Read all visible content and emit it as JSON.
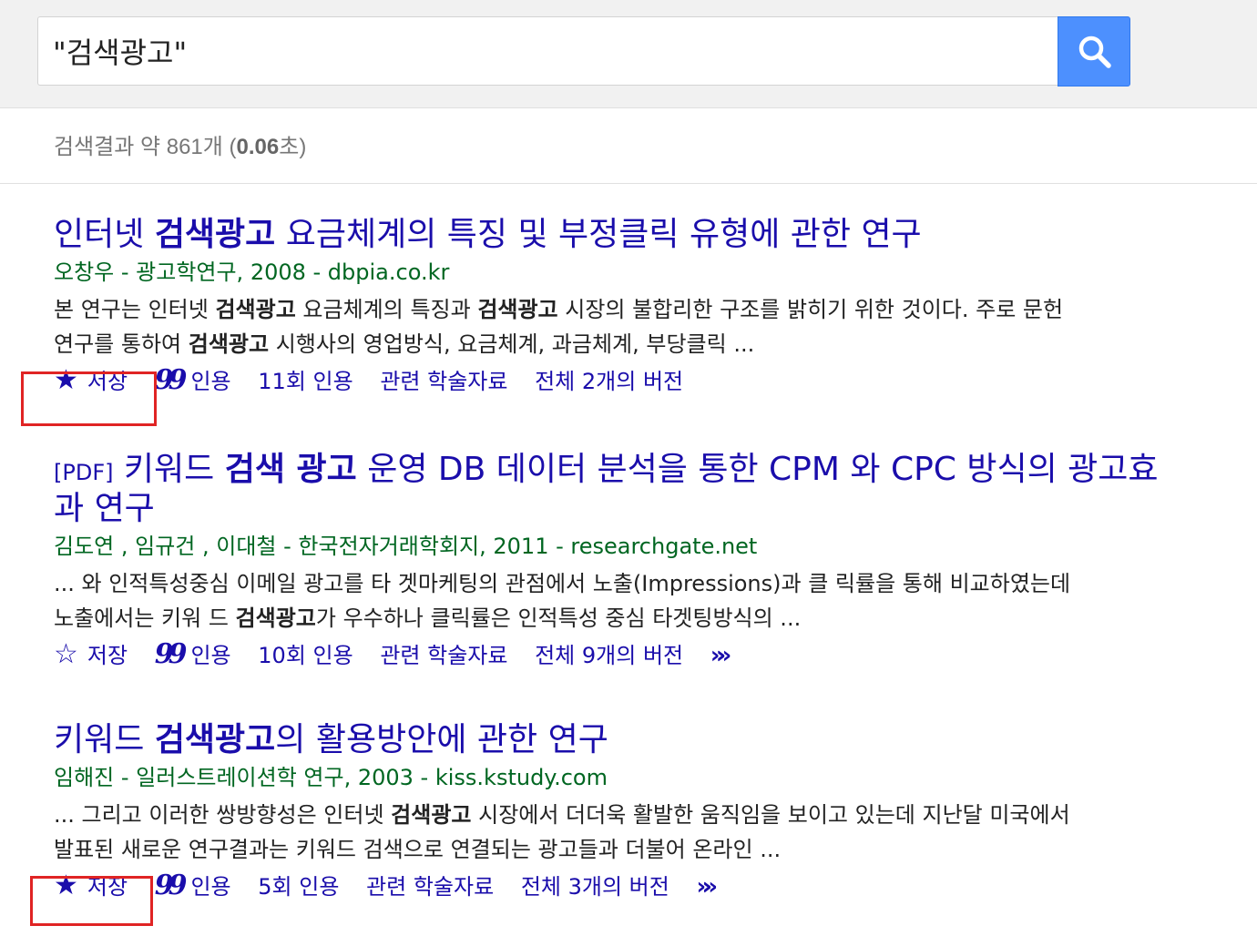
{
  "search": {
    "query": "\"검색광고\"",
    "button_icon": "search-icon",
    "button_color": "#4d90fe"
  },
  "stats": {
    "prefix": "검색결과 약 861개 (",
    "time": "0.06",
    "suffix": "초)"
  },
  "colors": {
    "title": "#1a0dab",
    "meta": "#006621",
    "highlight": "#e02424"
  },
  "results": [
    {
      "pdf_tag": "",
      "title_pre": "인터넷 ",
      "title_bold": "검색광고",
      "title_post": " 요금체계의 특징 및 부정클릭 유형에 관한 연구",
      "meta": "오창우 - 광고학연구, 2008 - dbpia.co.kr",
      "snippet": [
        {
          "t": "본 연구는 인터넷 "
        },
        {
          "b": "검색광고"
        },
        {
          "t": " 요금체계의 특징과 "
        },
        {
          "b": "검색광고"
        },
        {
          "t": " 시장의 불합리한 구조를 밝히기 위한 것이다. 주로 문헌연구를 통하여 "
        },
        {
          "b": "검색광고"
        },
        {
          "t": " 시행사의 영업방식, 요금체계, 과금체계, 부당클릭 ..."
        }
      ],
      "actions": {
        "save": "저장",
        "save_icon": "star-filled-icon",
        "cite": "인용",
        "cited_by": "11회 인용",
        "related": "관련 학술자료",
        "versions": "전체 2개의 버전",
        "more": false
      },
      "highlighted_save": true
    },
    {
      "pdf_tag": "[PDF]",
      "title_pre": " 키워드 ",
      "title_bold": "검색 광고",
      "title_post": " 운영 DB 데이터 분석을 통한 CPM 와 CPC 방식의 광고효과 연구",
      "meta": "김도연 ,  임규건 ,  이대철 - 한국전자거래학회지, 2011 - researchgate.net",
      "snippet": [
        {
          "t": "... 와 인적특성중심 이메일 광고를 타 겟마케팅의 관점에서 노출(Impressions)과 클 릭률을 통해 비교하였는데 노출에서는 키워 드 "
        },
        {
          "b": "검색광고"
        },
        {
          "t": "가 우수하나 클릭률은 인적특성 중심 타겟팅방식의 ..."
        }
      ],
      "actions": {
        "save": "저장",
        "save_icon": "star-outline-icon",
        "cite": "인용",
        "cited_by": "10회 인용",
        "related": "관련 학술자료",
        "versions": "전체 9개의 버전",
        "more": true
      },
      "highlighted_save": false
    },
    {
      "pdf_tag": "",
      "title_pre": "키워드 ",
      "title_bold": "검색광고",
      "title_post": "의 활용방안에 관한 연구",
      "meta": "임해진 - 일러스트레이션학 연구, 2003 - kiss.kstudy.com",
      "snippet": [
        {
          "t": "... 그리고 이러한 쌍방향성은 인터넷 "
        },
        {
          "b": "검색광고"
        },
        {
          "t": " 시장에서 더더욱 활발한 움직임을 보이고 있는데 지난달 미국에서 발표된 새로운 연구결과는 키워드 검색으로 연결되는 광고들과 더불어 온라인 ..."
        }
      ],
      "actions": {
        "save": "저장",
        "save_icon": "star-filled-icon",
        "cite": "인용",
        "cited_by": "5회 인용",
        "related": "관련 학술자료",
        "versions": "전체 3개의 버전",
        "more": true
      },
      "highlighted_save": true
    }
  ]
}
